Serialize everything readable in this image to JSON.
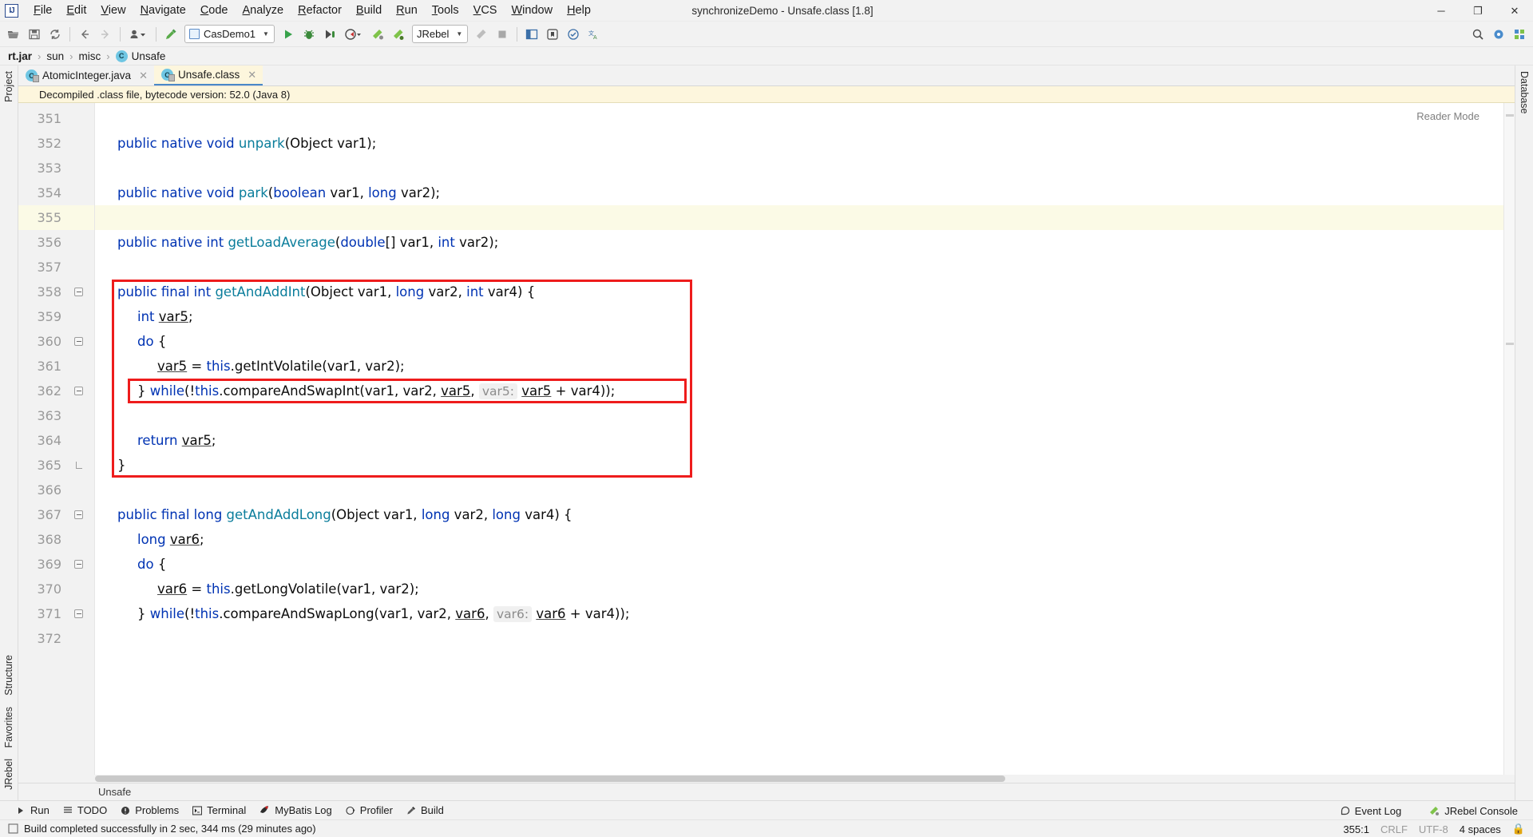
{
  "window": {
    "title": "synchronizeDemo - Unsafe.class [1.8]",
    "app_logo": "IJ",
    "controls": {
      "minimize": "─",
      "maximize": "❐",
      "close": "✕"
    }
  },
  "menu": [
    {
      "label": "File"
    },
    {
      "label": "Edit"
    },
    {
      "label": "View"
    },
    {
      "label": "Navigate"
    },
    {
      "label": "Code"
    },
    {
      "label": "Analyze"
    },
    {
      "label": "Refactor"
    },
    {
      "label": "Build"
    },
    {
      "label": "Run"
    },
    {
      "label": "Tools"
    },
    {
      "label": "VCS"
    },
    {
      "label": "Window"
    },
    {
      "label": "Help"
    }
  ],
  "toolbar": {
    "run_configuration": "CasDemo1",
    "jrebel_selector": "JRebel",
    "icons": [
      "open-folder-icon",
      "save-all-icon",
      "sync-icon",
      "back-arrow-icon",
      "forward-arrow-icon",
      "profile-dropdown-icon",
      "build-hammer-icon",
      "run-icon",
      "debug-icon",
      "run-coverage-icon",
      "profile-run-icon",
      "jrebel-run-icon",
      "jrebel-debug-icon",
      "stop-icon",
      "update-app-icon",
      "search-everywhere-icon",
      "settings-gear-icon",
      "notifications-icon"
    ]
  },
  "breadcrumb": {
    "items": [
      {
        "label": "rt.jar",
        "bold": true,
        "icon": null
      },
      {
        "label": "sun",
        "bold": false,
        "icon": null
      },
      {
        "label": "misc",
        "bold": false,
        "icon": null
      },
      {
        "label": "Unsafe",
        "bold": false,
        "icon": "class-icon"
      }
    ],
    "separator": "›"
  },
  "editor_tabs": [
    {
      "label": "AtomicInteger.java",
      "active": false,
      "icon": "java-class-icon",
      "close": "✕"
    },
    {
      "label": "Unsafe.class",
      "active": true,
      "icon": "java-class-icon",
      "close": "✕"
    }
  ],
  "banner": {
    "text": "Decompiled .class file, bytecode version: 52.0 (Java 8)"
  },
  "editor": {
    "reader_mode_label": "Reader Mode",
    "first_line": 351,
    "highlight_line": 355,
    "caret_line": 355,
    "lines": [
      {
        "n": 351,
        "tokens": []
      },
      {
        "n": 352,
        "tokens": [
          {
            "t": "public native void ",
            "c": "kw"
          },
          {
            "t": "unpark",
            "c": "mth"
          },
          {
            "t": "(Object var1);",
            "c": "var"
          }
        ]
      },
      {
        "n": 353,
        "tokens": []
      },
      {
        "n": 354,
        "tokens": [
          {
            "t": "public native void ",
            "c": "kw"
          },
          {
            "t": "park",
            "c": "mth"
          },
          {
            "t": "(",
            "c": "var"
          },
          {
            "t": "boolean",
            "c": "kw"
          },
          {
            "t": " var1, ",
            "c": "var"
          },
          {
            "t": "long",
            "c": "kw"
          },
          {
            "t": " var2);",
            "c": "var"
          }
        ]
      },
      {
        "n": 355,
        "tokens": []
      },
      {
        "n": 356,
        "tokens": [
          {
            "t": "public native int ",
            "c": "kw"
          },
          {
            "t": "getLoadAverage",
            "c": "mth"
          },
          {
            "t": "(",
            "c": "var"
          },
          {
            "t": "double",
            "c": "kw"
          },
          {
            "t": "[] var1, ",
            "c": "var"
          },
          {
            "t": "int",
            "c": "kw"
          },
          {
            "t": " var2);",
            "c": "var"
          }
        ]
      },
      {
        "n": 357,
        "tokens": []
      },
      {
        "n": 358,
        "tokens": [
          {
            "t": "public final int ",
            "c": "kw"
          },
          {
            "t": "getAndAddInt",
            "c": "mth"
          },
          {
            "t": "(Object var1, ",
            "c": "var"
          },
          {
            "t": "long",
            "c": "kw"
          },
          {
            "t": " var2, ",
            "c": "var"
          },
          {
            "t": "int",
            "c": "kw"
          },
          {
            "t": " var4) {",
            "c": "var"
          }
        ]
      },
      {
        "n": 359,
        "indent": 1,
        "tokens": [
          {
            "t": "int",
            "c": "kw"
          },
          {
            "t": " ",
            "c": "var"
          },
          {
            "t": "var5",
            "c": "loc"
          },
          {
            "t": ";",
            "c": "var"
          }
        ]
      },
      {
        "n": 360,
        "indent": 1,
        "tokens": [
          {
            "t": "do",
            "c": "kw"
          },
          {
            "t": " {",
            "c": "var"
          }
        ]
      },
      {
        "n": 361,
        "indent": 2,
        "tokens": [
          {
            "t": "var5",
            "c": "loc"
          },
          {
            "t": " = ",
            "c": "var"
          },
          {
            "t": "this",
            "c": "kw"
          },
          {
            "t": ".getIntVolatile(var1, var2);",
            "c": "var"
          }
        ]
      },
      {
        "n": 362,
        "indent": 1,
        "tokens": [
          {
            "t": "} ",
            "c": "var"
          },
          {
            "t": "while",
            "c": "kw"
          },
          {
            "t": "(!",
            "c": "var"
          },
          {
            "t": "this",
            "c": "kw"
          },
          {
            "t": ".compareAndSwapInt(var1, var2, ",
            "c": "var"
          },
          {
            "t": "var5",
            "c": "loc"
          },
          {
            "t": ", ",
            "c": "var"
          },
          {
            "t": "var5:",
            "c": "hint"
          },
          {
            "t": " ",
            "c": "var"
          },
          {
            "t": "var5",
            "c": "loc"
          },
          {
            "t": " + var4));",
            "c": "var"
          }
        ]
      },
      {
        "n": 363,
        "tokens": []
      },
      {
        "n": 364,
        "indent": 1,
        "tokens": [
          {
            "t": "return",
            "c": "kw"
          },
          {
            "t": " ",
            "c": "var"
          },
          {
            "t": "var5",
            "c": "loc"
          },
          {
            "t": ";",
            "c": "var"
          }
        ]
      },
      {
        "n": 365,
        "tokens": [
          {
            "t": "}",
            "c": "var"
          }
        ]
      },
      {
        "n": 366,
        "tokens": []
      },
      {
        "n": 367,
        "tokens": [
          {
            "t": "public final long ",
            "c": "kw"
          },
          {
            "t": "getAndAddLong",
            "c": "mth"
          },
          {
            "t": "(Object var1, ",
            "c": "var"
          },
          {
            "t": "long",
            "c": "kw"
          },
          {
            "t": " var2, ",
            "c": "var"
          },
          {
            "t": "long",
            "c": "kw"
          },
          {
            "t": " var4) {",
            "c": "var"
          }
        ]
      },
      {
        "n": 368,
        "indent": 1,
        "tokens": [
          {
            "t": "long",
            "c": "kw"
          },
          {
            "t": " ",
            "c": "var"
          },
          {
            "t": "var6",
            "c": "loc"
          },
          {
            "t": ";",
            "c": "var"
          }
        ]
      },
      {
        "n": 369,
        "indent": 1,
        "tokens": [
          {
            "t": "do",
            "c": "kw"
          },
          {
            "t": " {",
            "c": "var"
          }
        ]
      },
      {
        "n": 370,
        "indent": 2,
        "tokens": [
          {
            "t": "var6",
            "c": "loc"
          },
          {
            "t": " = ",
            "c": "var"
          },
          {
            "t": "this",
            "c": "kw"
          },
          {
            "t": ".getLongVolatile(var1, var2);",
            "c": "var"
          }
        ]
      },
      {
        "n": 371,
        "indent": 1,
        "tokens": [
          {
            "t": "} ",
            "c": "var"
          },
          {
            "t": "while",
            "c": "kw"
          },
          {
            "t": "(!",
            "c": "var"
          },
          {
            "t": "this",
            "c": "kw"
          },
          {
            "t": ".compareAndSwapLong(var1, var2, ",
            "c": "var"
          },
          {
            "t": "var6",
            "c": "loc"
          },
          {
            "t": ", ",
            "c": "var"
          },
          {
            "t": "var6:",
            "c": "hint"
          },
          {
            "t": " ",
            "c": "var"
          },
          {
            "t": "var6",
            "c": "loc"
          },
          {
            "t": " + var4));",
            "c": "var"
          }
        ]
      },
      {
        "n": 372,
        "tokens": []
      }
    ],
    "annotations": [
      {
        "name": "method-highlight-box",
        "color": "#ee1c1c"
      },
      {
        "name": "cas-loop-highlight-box",
        "color": "#ee1c1c"
      }
    ]
  },
  "left_tool_tabs": [
    {
      "label": "Project"
    },
    {
      "label": "Structure"
    },
    {
      "label": "Favorites"
    },
    {
      "label": "JRebel"
    }
  ],
  "right_tool_tabs": [
    {
      "label": "Database"
    }
  ],
  "bottom_breadcrumb": {
    "label": "Unsafe"
  },
  "tool_window_bar": {
    "items": [
      {
        "label": "Run",
        "icon": "run-icon"
      },
      {
        "label": "TODO",
        "icon": "todo-icon"
      },
      {
        "label": "Problems",
        "icon": "problems-icon"
      },
      {
        "label": "Terminal",
        "icon": "terminal-icon"
      },
      {
        "label": "MyBatis Log",
        "icon": "mybatis-icon"
      },
      {
        "label": "Profiler",
        "icon": "profiler-icon"
      },
      {
        "label": "Build",
        "icon": "build-hammer-icon"
      }
    ],
    "right_items": [
      {
        "label": "Event Log",
        "icon": "event-log-icon"
      },
      {
        "label": "JRebel Console",
        "icon": "jrebel-icon"
      }
    ]
  },
  "status_bar": {
    "message": "Build completed successfully in 2 sec, 344 ms (29 minutes ago)",
    "message_icon": "build-status-icon",
    "caret_position": "355:1",
    "line_separator": "CRLF",
    "encoding": "UTF-8",
    "indent": "4 spaces"
  },
  "colors": {
    "keyword": "#0033b3",
    "method": "#0a7d9b",
    "text": "#0c0c0c",
    "hint": "#8c8c8c",
    "annotation_red": "#ee1c1c",
    "tab_active_bg": "#fdf6dd",
    "banner_bg": "#fdf6dd",
    "line_highlight": "#fbfae6",
    "chrome_bg": "#f2f2f2"
  }
}
